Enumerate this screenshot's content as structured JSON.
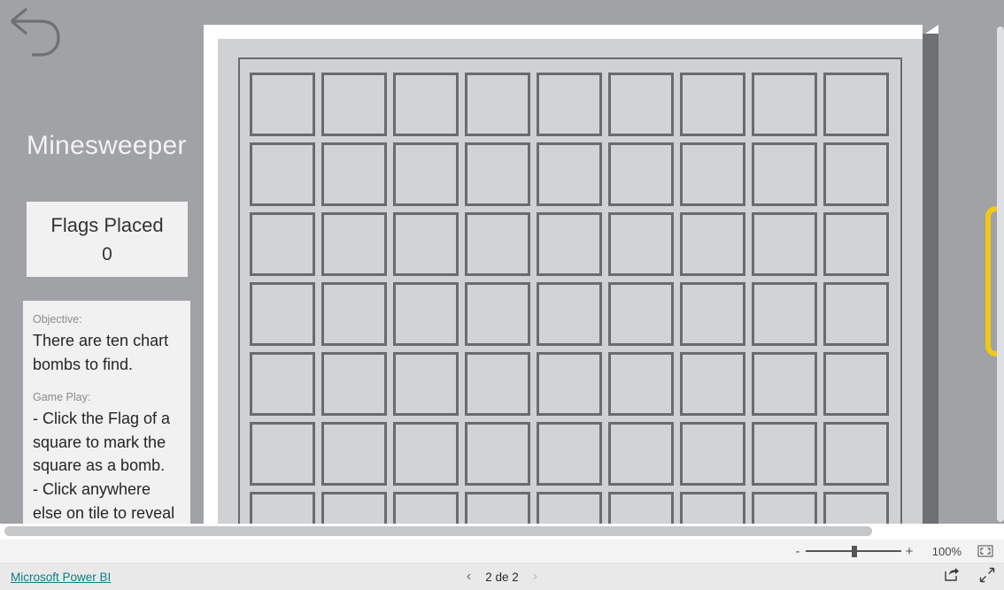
{
  "report": {
    "back_icon": "back-arrow-icon",
    "title": "Minesweeper",
    "kpi": {
      "label": "Flags Placed",
      "value": "0"
    },
    "instructions": {
      "objective_heading": "Objective:",
      "objective_text": "There are ten chart bombs to find.",
      "gameplay_heading": "Game Play:",
      "gameplay_line1": "- Click the Flag of a square to mark the square as a bomb.",
      "gameplay_line2": "- Click anywhere else on tile to reveal"
    },
    "board": {
      "columns": 9,
      "rows": 7,
      "tile_fill": "#d2d3d5",
      "tile_border": "#6a6b6e"
    },
    "colors": {
      "canvas_background": "#a0a2a6",
      "card_background": "#f1f1f1",
      "board_panel": "#d0d1d3",
      "highlight_yellow": "#f2c816",
      "link_teal": "#117a87"
    }
  },
  "zoombar": {
    "minus_label": "-",
    "plus_label": "+",
    "zoom_level": "100%",
    "fit_icon": "fit-to-page-icon",
    "slider_icon": "zoom-slider"
  },
  "footer": {
    "brand_link": "Microsoft Power BI",
    "prev_icon": "chevron-left-icon",
    "next_icon": "chevron-right-icon",
    "page_label": "2 de 2",
    "share_icon": "share-icon",
    "fullscreen_icon": "fullscreen-icon"
  }
}
